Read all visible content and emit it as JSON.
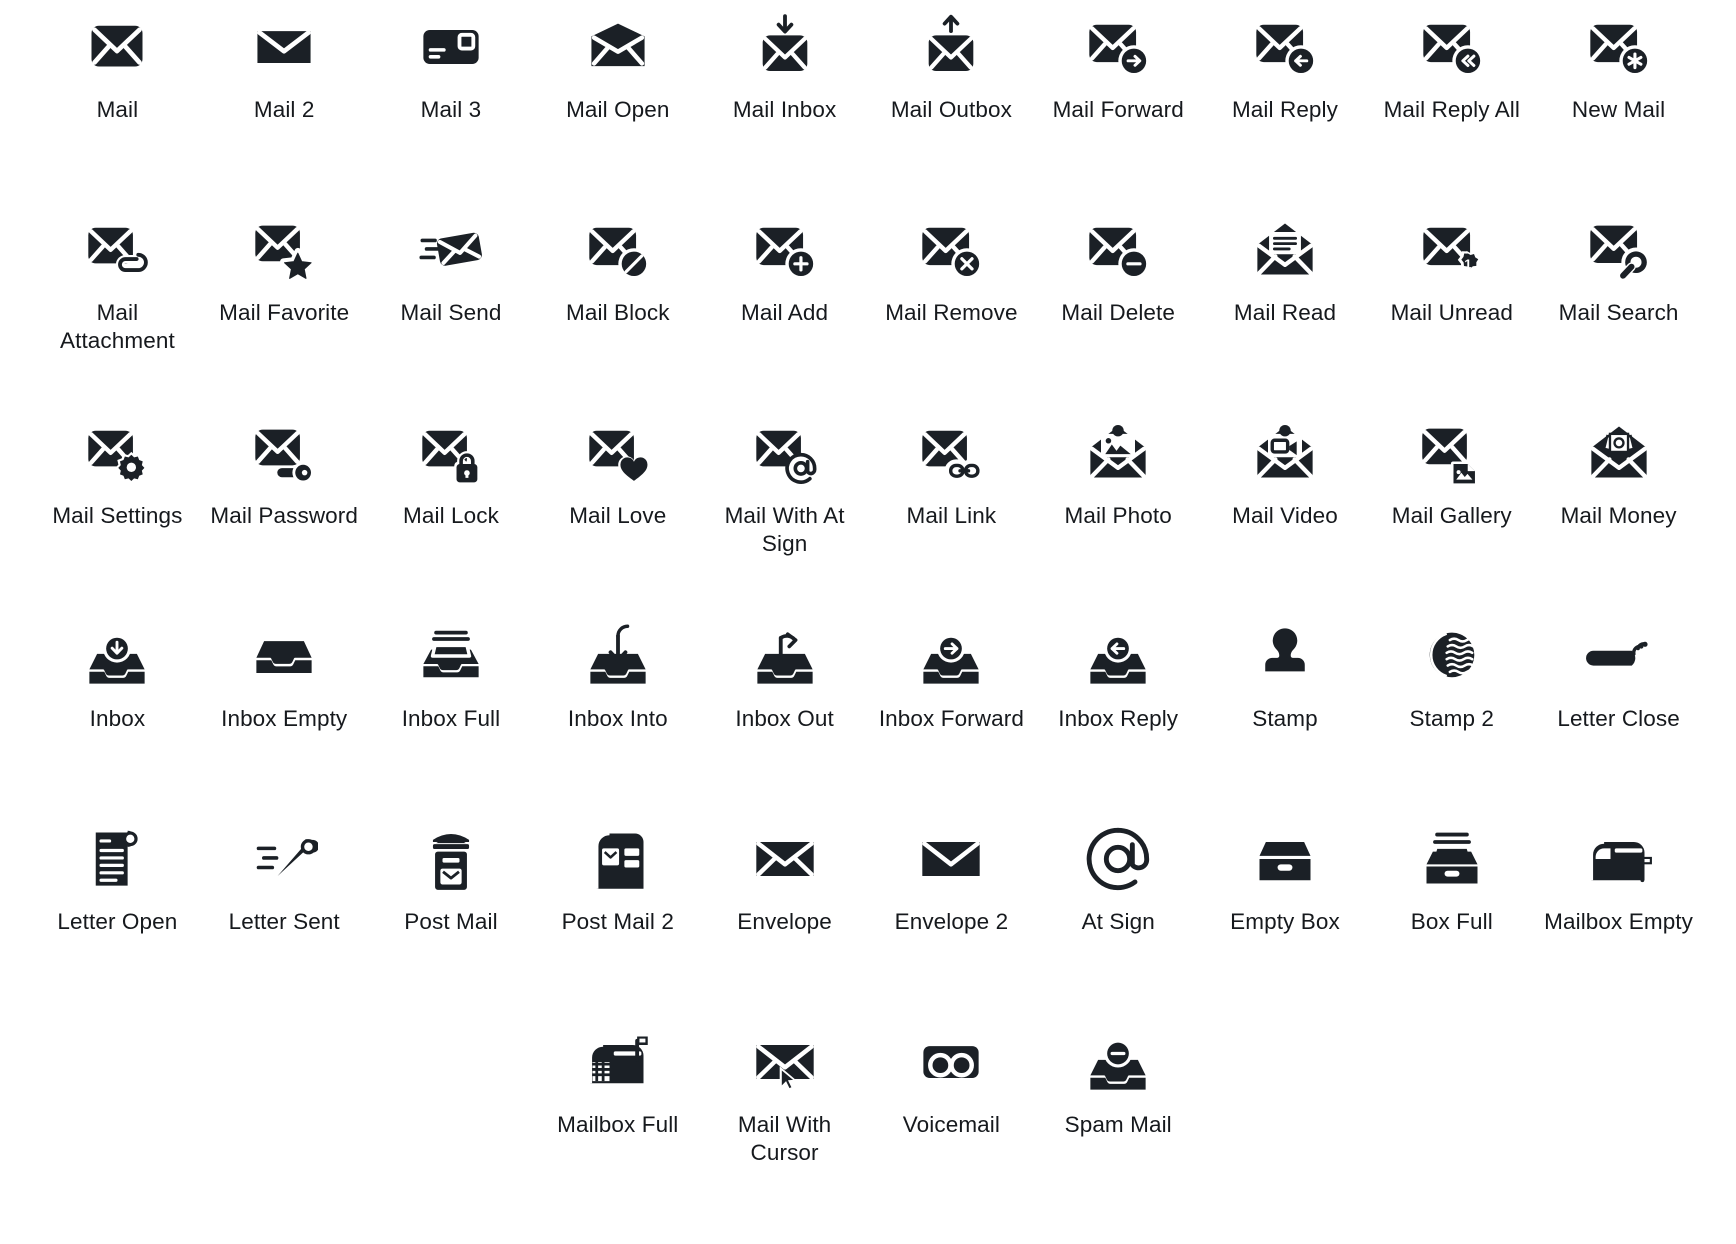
{
  "page": {
    "background": "#ffffff",
    "icon_color": "#1b2026",
    "label_color": "#16191d",
    "columns": 10,
    "rows": 6
  },
  "icons": [
    {
      "id": "mail",
      "label": "Mail"
    },
    {
      "id": "mail-2",
      "label": "Mail 2"
    },
    {
      "id": "mail-3",
      "label": "Mail 3"
    },
    {
      "id": "mail-open",
      "label": "Mail Open"
    },
    {
      "id": "mail-inbox",
      "label": "Mail Inbox"
    },
    {
      "id": "mail-outbox",
      "label": "Mail Outbox"
    },
    {
      "id": "mail-forward",
      "label": "Mail Forward"
    },
    {
      "id": "mail-reply",
      "label": "Mail Reply"
    },
    {
      "id": "mail-reply-all",
      "label": "Mail Reply All"
    },
    {
      "id": "new-mail",
      "label": "New Mail"
    },
    {
      "id": "mail-attachment",
      "label": "Mail Attachment"
    },
    {
      "id": "mail-favorite",
      "label": "Mail Favorite"
    },
    {
      "id": "mail-send",
      "label": "Mail Send"
    },
    {
      "id": "mail-block",
      "label": "Mail Block"
    },
    {
      "id": "mail-add",
      "label": "Mail Add"
    },
    {
      "id": "mail-remove",
      "label": "Mail Remove"
    },
    {
      "id": "mail-delete",
      "label": "Mail Delete"
    },
    {
      "id": "mail-read",
      "label": "Mail Read"
    },
    {
      "id": "mail-unread",
      "label": "Mail Unread"
    },
    {
      "id": "mail-search",
      "label": "Mail Search"
    },
    {
      "id": "mail-settings",
      "label": "Mail Settings"
    },
    {
      "id": "mail-password",
      "label": "Mail Password"
    },
    {
      "id": "mail-lock",
      "label": "Mail Lock"
    },
    {
      "id": "mail-love",
      "label": "Mail Love"
    },
    {
      "id": "mail-with-at-sign",
      "label": "Mail With At Sign"
    },
    {
      "id": "mail-link",
      "label": "Mail Link"
    },
    {
      "id": "mail-photo",
      "label": "Mail Photo"
    },
    {
      "id": "mail-video",
      "label": "Mail Video"
    },
    {
      "id": "mail-gallery",
      "label": "Mail Gallery"
    },
    {
      "id": "mail-money",
      "label": "Mail Money"
    },
    {
      "id": "inbox",
      "label": "Inbox"
    },
    {
      "id": "inbox-empty",
      "label": "Inbox Empty"
    },
    {
      "id": "inbox-full",
      "label": "Inbox Full"
    },
    {
      "id": "inbox-into",
      "label": "Inbox Into"
    },
    {
      "id": "inbox-out",
      "label": "Inbox Out"
    },
    {
      "id": "inbox-forward",
      "label": "Inbox Forward"
    },
    {
      "id": "inbox-reply",
      "label": "Inbox Reply"
    },
    {
      "id": "stamp",
      "label": "Stamp"
    },
    {
      "id": "stamp-2",
      "label": "Stamp 2"
    },
    {
      "id": "letter-close",
      "label": "Letter Close"
    },
    {
      "id": "letter-open",
      "label": "Letter Open"
    },
    {
      "id": "letter-sent",
      "label": "Letter Sent"
    },
    {
      "id": "post-mail",
      "label": "Post Mail"
    },
    {
      "id": "post-mail-2",
      "label": "Post Mail 2"
    },
    {
      "id": "envelope",
      "label": "Envelope"
    },
    {
      "id": "envelope-2",
      "label": "Envelope 2"
    },
    {
      "id": "at-sign",
      "label": "At Sign"
    },
    {
      "id": "empty-box",
      "label": "Empty Box"
    },
    {
      "id": "box-full",
      "label": "Box Full"
    },
    {
      "id": "mailbox-empty",
      "label": "Mailbox Empty"
    },
    {
      "id": "mailbox-full",
      "label": "Mailbox Full"
    },
    {
      "id": "mail-with-cursor",
      "label": "Mail With Cursor"
    },
    {
      "id": "voicemail",
      "label": "Voicemail"
    },
    {
      "id": "spam-mail",
      "label": "Spam Mail"
    }
  ]
}
